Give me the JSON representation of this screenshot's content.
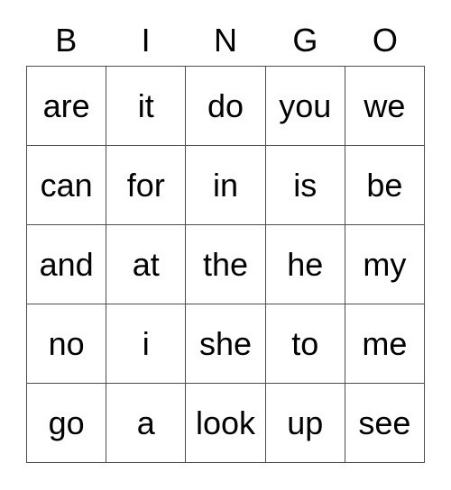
{
  "card": {
    "title": "BINGO",
    "columns": [
      "B",
      "I",
      "N",
      "G",
      "O"
    ],
    "colors": {
      "background": "#ffffff",
      "text": "#000000",
      "border": "#4d4d4d"
    },
    "grid": {
      "rows": 5,
      "cols": 5,
      "cells": [
        [
          {
            "word": "are"
          },
          {
            "word": "it"
          },
          {
            "word": "do"
          },
          {
            "word": "you"
          },
          {
            "word": "we"
          }
        ],
        [
          {
            "word": "can"
          },
          {
            "word": "for"
          },
          {
            "word": "in"
          },
          {
            "word": "is"
          },
          {
            "word": "be"
          }
        ],
        [
          {
            "word": "and"
          },
          {
            "word": "at"
          },
          {
            "word": "the"
          },
          {
            "word": "he"
          },
          {
            "word": "my"
          }
        ],
        [
          {
            "word": "no"
          },
          {
            "word": "i"
          },
          {
            "word": "she"
          },
          {
            "word": "to"
          },
          {
            "word": "me"
          }
        ],
        [
          {
            "word": "go"
          },
          {
            "word": "a"
          },
          {
            "word": "look"
          },
          {
            "word": "up"
          },
          {
            "word": "see"
          }
        ]
      ]
    }
  }
}
